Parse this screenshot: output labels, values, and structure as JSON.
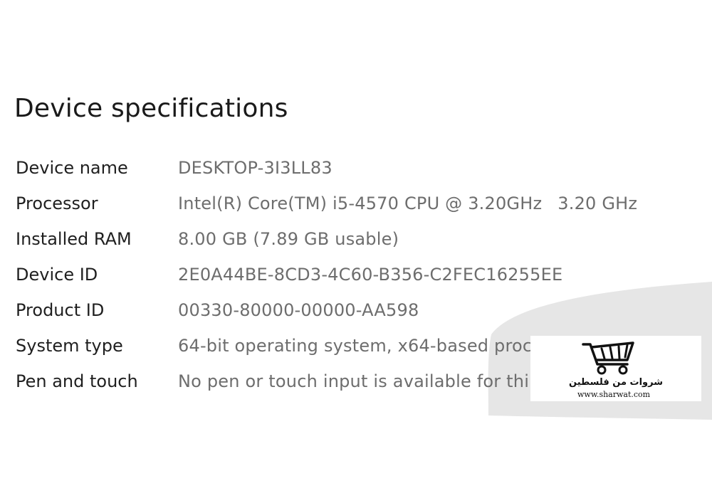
{
  "section": {
    "title": "Device specifications"
  },
  "specs": [
    {
      "label": "Device name",
      "value": "DESKTOP-3I3LL83",
      "value_extra": ""
    },
    {
      "label": "Processor",
      "value": "Intel(R) Core(TM) i5-4570 CPU @ 3.20GHz",
      "value_extra": "3.20 GHz"
    },
    {
      "label": "Installed RAM",
      "value": "8.00 GB (7.89 GB usable)",
      "value_extra": ""
    },
    {
      "label": "Device ID",
      "value": "2E0A44BE-8CD3-4C60-B356-C2FEC16255EE",
      "value_extra": ""
    },
    {
      "label": "Product ID",
      "value": "00330-80000-00000-AA598",
      "value_extra": ""
    },
    {
      "label": "System type",
      "value": "64-bit operating system, x64-based proc",
      "value_extra": ""
    },
    {
      "label": "Pen and touch",
      "value": "No pen or touch input is available for thi",
      "value_extra": ""
    }
  ],
  "watermark": {
    "icon": "shopping-cart-icon",
    "brand_arabic": "شروات من فلسطين",
    "url": "www.sharwat.com"
  },
  "colors": {
    "background": "#ffffff",
    "label_text": "#1f1f1f",
    "value_text": "#6d6d6d",
    "decor_grey": "#e6e6e6"
  }
}
